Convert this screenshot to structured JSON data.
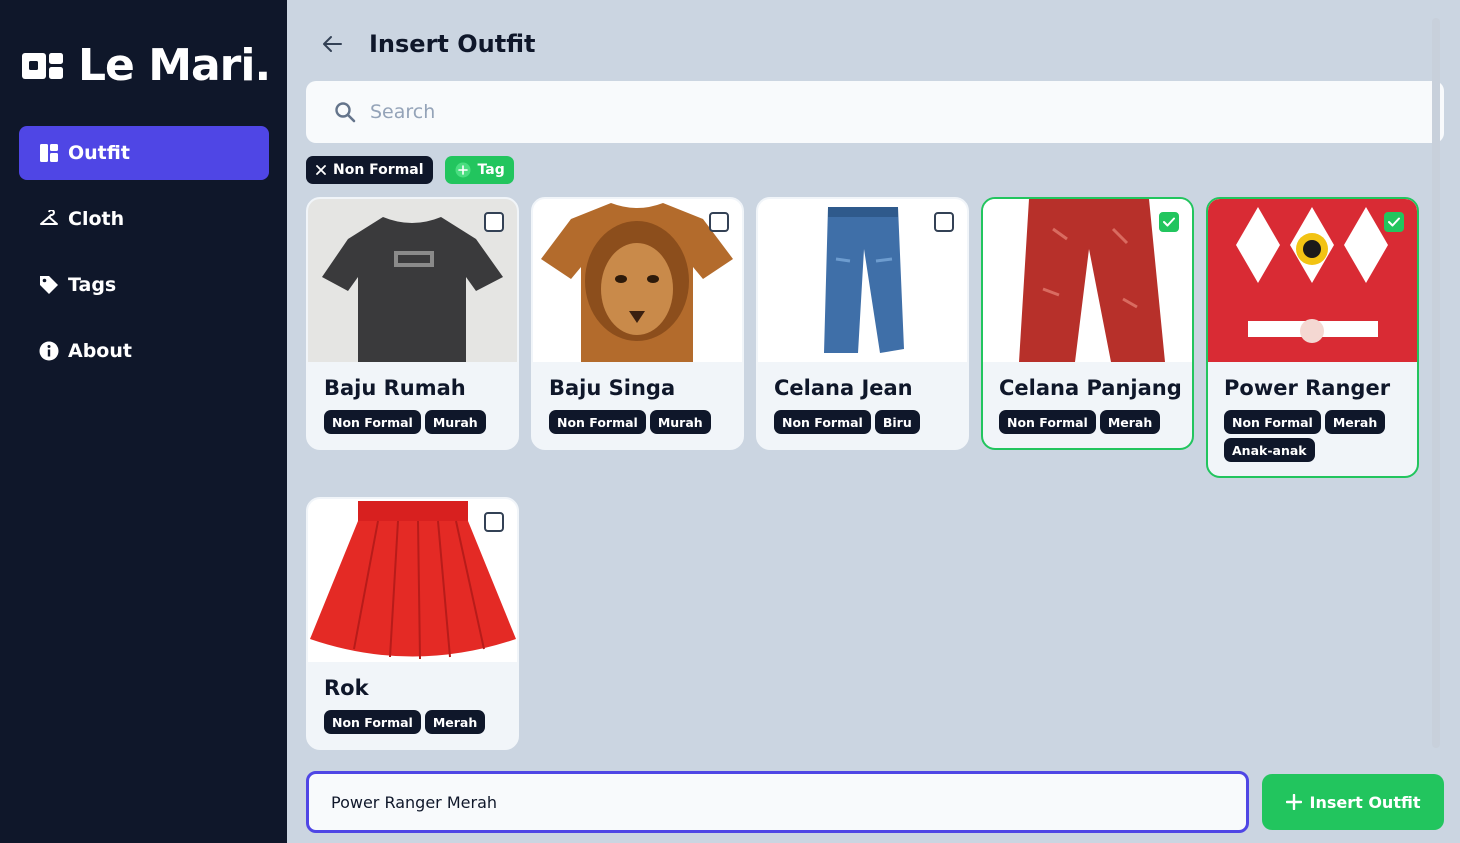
{
  "app": {
    "name": "Le Mari."
  },
  "sidebar": {
    "items": [
      {
        "label": "Outfit",
        "icon": "dashboard-icon",
        "active": true
      },
      {
        "label": "Cloth",
        "icon": "hanger-icon",
        "active": false
      },
      {
        "label": "Tags",
        "icon": "tag-icon",
        "active": false
      },
      {
        "label": "About",
        "icon": "info-icon",
        "active": false
      }
    ]
  },
  "header": {
    "title": "Insert Outfit"
  },
  "search": {
    "placeholder": "Search",
    "value": ""
  },
  "filters": {
    "active": [
      {
        "label": "Non Formal"
      }
    ],
    "add_label": "Tag"
  },
  "cards": [
    {
      "name": "Baju Rumah",
      "image": "black-tshirt",
      "selected": false,
      "tags": [
        "Non Formal",
        "Murah"
      ]
    },
    {
      "name": "Baju Singa",
      "image": "lion-tshirt",
      "selected": false,
      "tags": [
        "Non Formal",
        "Murah"
      ]
    },
    {
      "name": "Celana Jean",
      "image": "blue-jeans",
      "selected": false,
      "tags": [
        "Non Formal",
        "Biru"
      ]
    },
    {
      "name": "Celana Panjang",
      "image": "red-pants",
      "selected": true,
      "tags": [
        "Non Formal",
        "Merah"
      ]
    },
    {
      "name": "Power Ranger",
      "image": "red-ranger-shirt",
      "selected": true,
      "tags": [
        "Non Formal",
        "Merah",
        "Anak-anak"
      ]
    },
    {
      "name": "Rok",
      "image": "red-skirt",
      "selected": false,
      "tags": [
        "Non Formal",
        "Merah"
      ]
    }
  ],
  "outfit_name": {
    "value": "Power Ranger Merah"
  },
  "insert_button": {
    "label": "Insert Outfit"
  },
  "colors": {
    "sidebar_bg": "#0f172a",
    "accent": "#4f46e5",
    "success": "#22c55e",
    "bg": "#cbd5e1"
  }
}
